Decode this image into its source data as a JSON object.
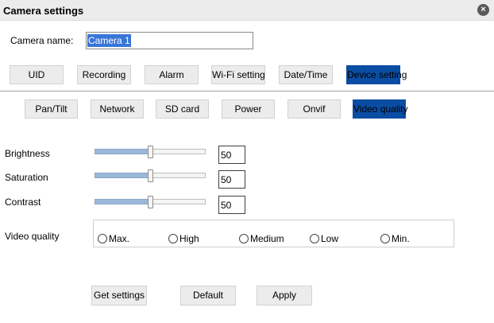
{
  "window": {
    "title": "Camera settings",
    "close_icon": "×"
  },
  "camera_name": {
    "label": "Camera name:",
    "value": "Camera 1"
  },
  "main_tabs": [
    {
      "label": "UID"
    },
    {
      "label": "Recording"
    },
    {
      "label": "Alarm"
    },
    {
      "label": "Wi-Fi setting"
    },
    {
      "label": "Date/Time"
    },
    {
      "label": "Device setting",
      "active": true
    }
  ],
  "sub_tabs": [
    {
      "label": "Pan/Tilt"
    },
    {
      "label": "Network"
    },
    {
      "label": "SD card"
    },
    {
      "label": "Power"
    },
    {
      "label": "Onvif"
    },
    {
      "label": "Video quality",
      "active": true
    }
  ],
  "sliders": [
    {
      "label": "Brightness",
      "value": "50",
      "fraction": 0.5
    },
    {
      "label": "Saturation",
      "value": "50",
      "fraction": 0.5
    },
    {
      "label": "Contrast",
      "value": "50",
      "fraction": 0.5
    }
  ],
  "video_quality": {
    "label": "Video quality",
    "options": [
      "Max.",
      "High",
      "Medium",
      "Low",
      "Min."
    ],
    "selected": null
  },
  "actions": {
    "get_settings": "Get settings",
    "default": "Default",
    "apply": "Apply"
  },
  "colors": {
    "active_tab": "#0a4da2",
    "slider_fill": "#9cb8d8",
    "selection": "#3875d7"
  }
}
